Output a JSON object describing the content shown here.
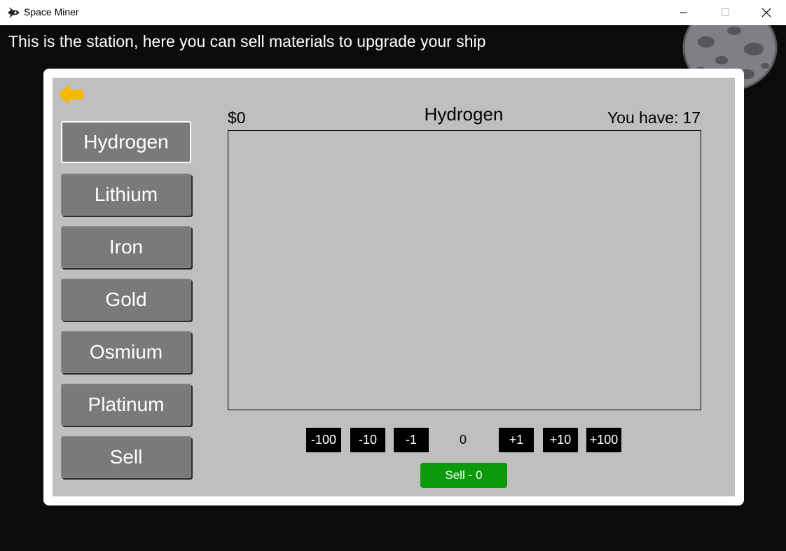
{
  "window": {
    "title": "Space Miner",
    "icons": {
      "app": "spaceship-icon",
      "minimize": "minimize-icon",
      "maximize": "maximize-icon",
      "close": "close-icon"
    }
  },
  "banner": "This is the station, here you can sell materials to upgrade your ship",
  "station": {
    "back_icon": "back-arrow-icon",
    "accent": "#f5b800",
    "materials": [
      "Hydrogen",
      "Lithium",
      "Iron",
      "Gold",
      "Osmium",
      "Platinum",
      "Sell"
    ],
    "selected_material": "Hydrogen",
    "money": "$0",
    "title": "Hydrogen",
    "have_label": "You have:",
    "have_count": "17",
    "quantity_buttons": [
      "-100",
      "-10",
      "-1",
      "+1",
      "+10",
      "+100"
    ],
    "quantity_value": "0",
    "sell_label": "Sell -",
    "sell_count": "0",
    "sell_color": "#0a9a0a"
  }
}
